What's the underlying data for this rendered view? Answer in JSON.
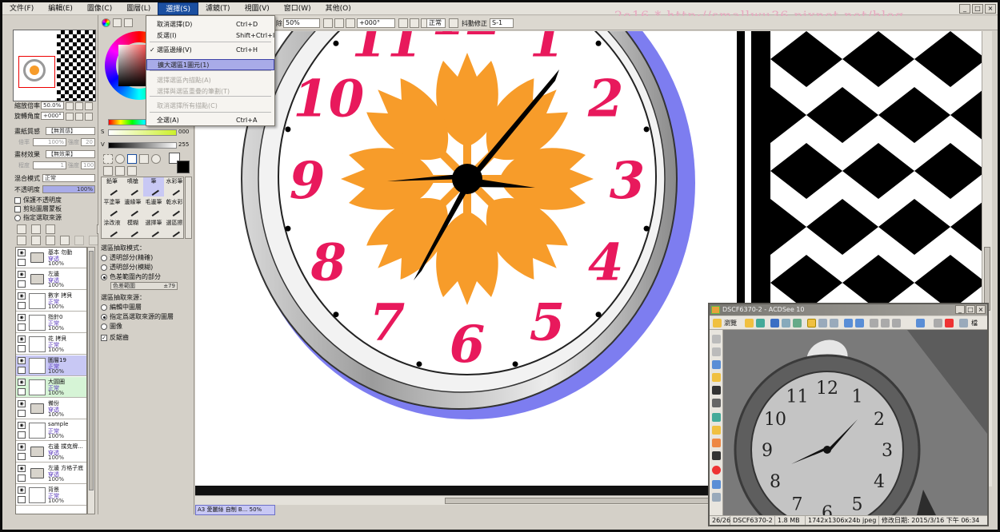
{
  "menubar": {
    "items": [
      "文件(F)",
      "編輯(E)",
      "圖像(C)",
      "圖層(L)",
      "選擇(S)",
      "濾鏡(T)",
      "視圖(V)",
      "窗口(W)",
      "其他(O)"
    ],
    "active_index": 4
  },
  "watermark": "2o16 * http://smallwu36.pixnet.net/blog",
  "window_controls": [
    "_",
    "□",
    "×"
  ],
  "toolbar": {
    "partial_label": "除",
    "zoom": "50%",
    "angle": "+000°",
    "mode": "正常",
    "stabilizer_label": "抖動修正",
    "stabilizer_value": "S-1"
  },
  "select_menu": {
    "items": [
      {
        "label": "取消選擇(D)",
        "shortcut": "Ctrl+D",
        "state": "normal",
        "checked": false
      },
      {
        "label": "反選(I)",
        "shortcut": "Shift+Ctrl+I",
        "state": "normal",
        "checked": false
      },
      {
        "label": "選區邊緣(V)",
        "shortcut": "Ctrl+H",
        "state": "normal",
        "checked": true
      },
      {
        "label": "擴大選區1圖元(1)",
        "shortcut": "",
        "state": "highlighted",
        "checked": false
      },
      {
        "label": "選擇選區內描點(A)",
        "shortcut": "",
        "state": "disabled",
        "checked": false
      },
      {
        "label": "選擇與選區重疊的筆劃(T)",
        "shortcut": "",
        "state": "disabled",
        "checked": false
      },
      {
        "label": "取消選擇所有描點(C)",
        "shortcut": "",
        "state": "disabled",
        "checked": false
      },
      {
        "label": "全選(A)",
        "shortcut": "Ctrl+A",
        "state": "normal",
        "checked": false
      }
    ]
  },
  "navigator": {
    "zoom_label": "縮放倍率",
    "zoom_value": "50.0%",
    "rotate_label": "旋轉角度",
    "rotate_value": "+000°"
  },
  "paper": {
    "texture_label": "畫紙質感",
    "texture_value": "【無質感】",
    "texture_sub1": "倍率",
    "texture_sub1_val": "100%",
    "texture_sub2": "強度",
    "texture_sub2_val": "20",
    "effect_label": "畫材效果",
    "effect_value": "【無效果】",
    "effect_sub1": "程度",
    "effect_sub1_val": "1",
    "effect_sub2": "強度",
    "effect_sub2_val": "100"
  },
  "blend": {
    "mode_label": "混合模式",
    "mode_value": "正常",
    "opacity_label": "不透明度",
    "opacity_value": "100%",
    "checks": [
      "保護不透明度",
      "剪貼圖層蒙板",
      "指定選取來源"
    ]
  },
  "layers": [
    {
      "name": "基本 勿動",
      "mode": "穿透",
      "opacity": "100%",
      "type": "folder",
      "selected": false,
      "green": false
    },
    {
      "name": "左邊",
      "mode": "穿透",
      "opacity": "100%",
      "type": "folder",
      "selected": false,
      "green": false
    },
    {
      "name": "數字 拷貝",
      "mode": "正常",
      "opacity": "100%",
      "type": "layer",
      "selected": false,
      "green": false
    },
    {
      "name": "指針0",
      "mode": "正常",
      "opacity": "100%",
      "type": "layer",
      "selected": false,
      "green": false
    },
    {
      "name": "花 拷貝",
      "mode": "正常",
      "opacity": "100%",
      "type": "layer",
      "selected": false,
      "green": false
    },
    {
      "name": "圖層19",
      "mode": "正常",
      "opacity": "100%",
      "type": "layer",
      "selected": true,
      "green": false
    },
    {
      "name": "大圓圈",
      "mode": "正常",
      "opacity": "100%",
      "type": "layer",
      "selected": false,
      "green": true
    },
    {
      "name": "備份",
      "mode": "穿透",
      "opacity": "100%",
      "type": "folder",
      "selected": false,
      "green": false
    },
    {
      "name": "sample",
      "mode": "正常",
      "opacity": "100%",
      "type": "layer",
      "selected": false,
      "green": false
    },
    {
      "name": "右邊 撲克牌...",
      "mode": "穿透",
      "opacity": "100%",
      "type": "folder",
      "selected": false,
      "green": false
    },
    {
      "name": "左邊 方格子底",
      "mode": "穿透",
      "opacity": "100%",
      "type": "folder",
      "selected": false,
      "green": false
    },
    {
      "name": "背景",
      "mode": "正常",
      "opacity": "100%",
      "type": "layer",
      "selected": false,
      "green": false
    }
  ],
  "color": {
    "s_label": "S",
    "s_value": "000",
    "v_label": "V",
    "v_value": "255"
  },
  "brushes": [
    [
      "鉛筆",
      "噴槍",
      "筆",
      "水彩筆"
    ],
    [
      "平塗筆",
      "邊緣筆",
      "毛邊筆",
      "乾水彩"
    ],
    [
      "涂改液",
      "模糊",
      "選擇筆",
      "選區擦"
    ]
  ],
  "selection_options": {
    "mode_label": "選區抽取模式：",
    "modes": [
      "透明部分(精確)",
      "透明部分(模糊)",
      "色差範圍內的部分"
    ],
    "mode_selected": 2,
    "range_label": "色差範圍",
    "range_value": "±79",
    "source_label": "選區抽取來源：",
    "sources": [
      "編輯中圖層",
      "指定爲選取來源的圖層",
      "圖像"
    ],
    "source_selected": 1,
    "antialias": "反鋸齒"
  },
  "document_tab": "A3 愛麗絲 自制 B...   50%",
  "clock": {
    "numerals": [
      "12",
      "1",
      "2",
      "3",
      "4",
      "5",
      "6",
      "7",
      "8",
      "9",
      "10",
      "11"
    ]
  },
  "viewer": {
    "title": "DSCF6370-2 - ACDSee 10",
    "browse_label": "瀏覽",
    "status": [
      "26/26",
      "DSCF6370-2",
      "1.8 MB",
      "1742x1306x24b jpeg",
      "修改日期: 2015/3/16 下午 06:34"
    ],
    "side_label": "檔"
  },
  "colors": {
    "accent": "#1b4fa0",
    "menu_highlight": "#a8abe8",
    "clock_numerals": "#e8195c",
    "flower": "#f79c2a",
    "rim_purple": "#7d7df0"
  }
}
